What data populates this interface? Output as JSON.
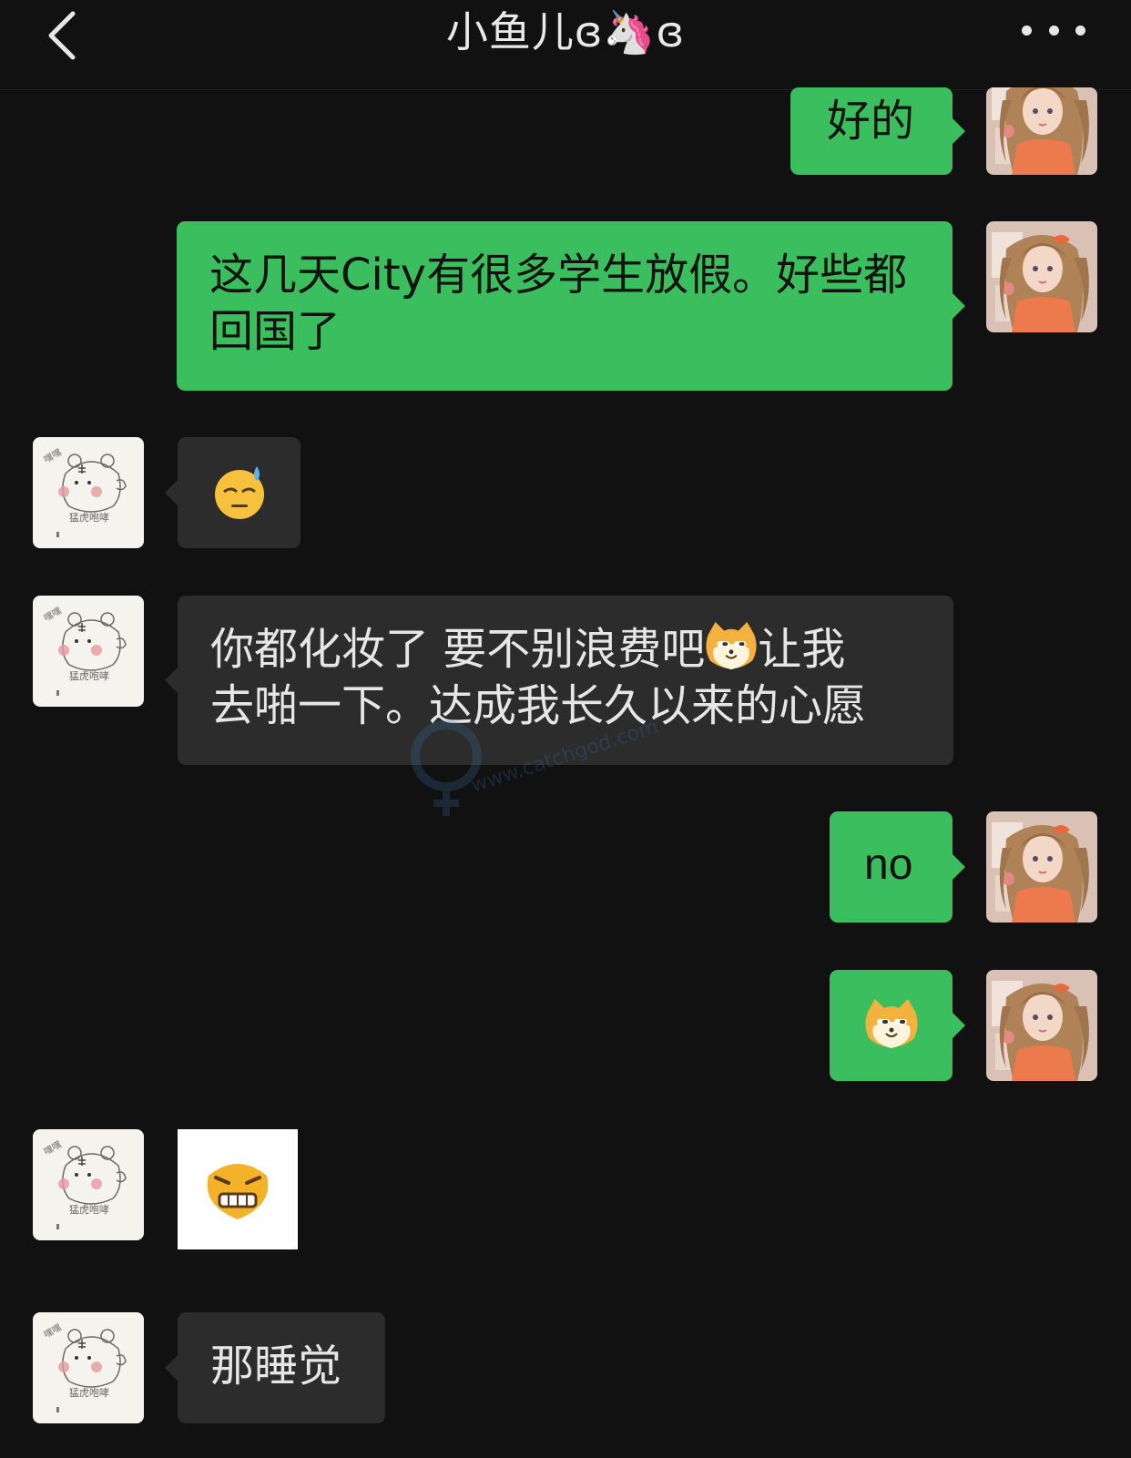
{
  "header": {
    "title": "小鱼儿ɞ🦄ɞ",
    "back_icon": "chevron-left-icon",
    "more_icon": "more-dots-icon"
  },
  "colors": {
    "background": "#111111",
    "my_bubble": "#3bbf5e",
    "friend_bubble": "#2c2c2c"
  },
  "messages": [
    {
      "from": "me",
      "type": "text",
      "text": "好的"
    },
    {
      "from": "me",
      "type": "text",
      "text": "这几天City有很多学生放假。好些都回国了"
    },
    {
      "from": "friend",
      "type": "emoji",
      "emoji": "sweat-smile-emoji"
    },
    {
      "from": "friend",
      "type": "text",
      "line1": "你都化妆了 要不别浪费吧",
      "line1_after": "让我",
      "line2": "去啪一下。达成我长久以来的心愿",
      "inline_emoji": "doge-emoji"
    },
    {
      "from": "me",
      "type": "text",
      "text": "no"
    },
    {
      "from": "me",
      "type": "emoji",
      "emoji": "doge-emoji"
    },
    {
      "from": "friend",
      "type": "sticker",
      "emoji": "grimace-emoji"
    },
    {
      "from": "friend",
      "type": "text",
      "text": "那睡觉"
    }
  ],
  "friend_avatar_text": {
    "top": "嘿嘿",
    "bottom": "猛虎咆哮"
  },
  "watermark_text": "www.catchgod.com"
}
